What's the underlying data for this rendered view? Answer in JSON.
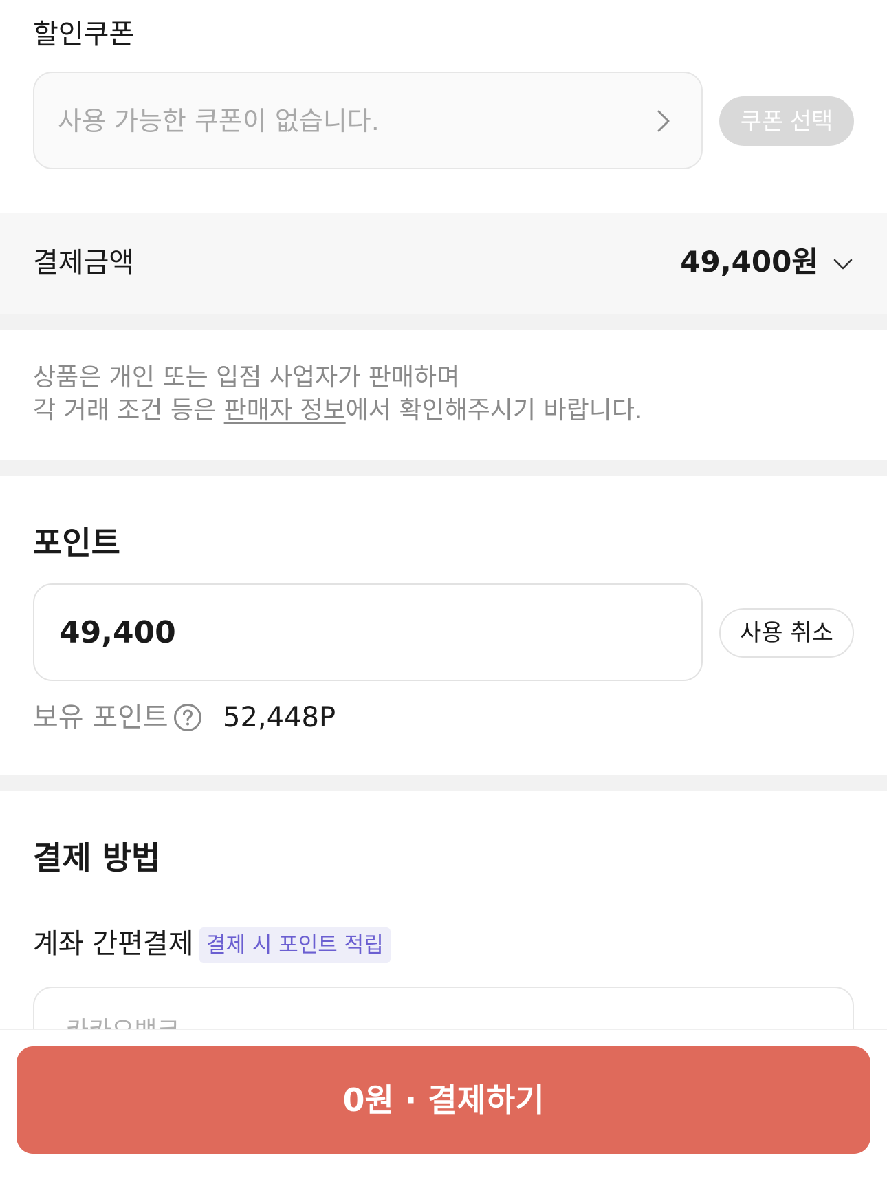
{
  "coupon": {
    "heading": "할인쿠폰",
    "placeholder": "사용 가능한 쿠폰이 없습니다.",
    "select_label": "쿠폰 선택"
  },
  "payment_amount": {
    "label": "결제금액",
    "value": "49,400원"
  },
  "notice": {
    "line1": "상품은 개인 또는 입점 사업자가 판매하며",
    "line2_before": "각 거래 조건 등은 ",
    "line2_link": "판매자 정보",
    "line2_after": "에서 확인해주시기 바랍니다."
  },
  "points": {
    "title": "포인트",
    "input_value": "49,400",
    "cancel_label": "사용 취소",
    "owned_label": "보유 포인트",
    "owned_value": "52,448P"
  },
  "payment_method": {
    "title": "결제 방법",
    "method_label": "계좌 간편결제",
    "badge": "결제 시 포인트 적립",
    "bank_name": "카카오뱅크"
  },
  "checkout": {
    "amount": "0원",
    "separator": "·",
    "action": "결제하기",
    "color": "#df6a5b"
  },
  "icons": [
    "chevron-right-icon",
    "chevron-down-icon",
    "question-circle-icon"
  ]
}
